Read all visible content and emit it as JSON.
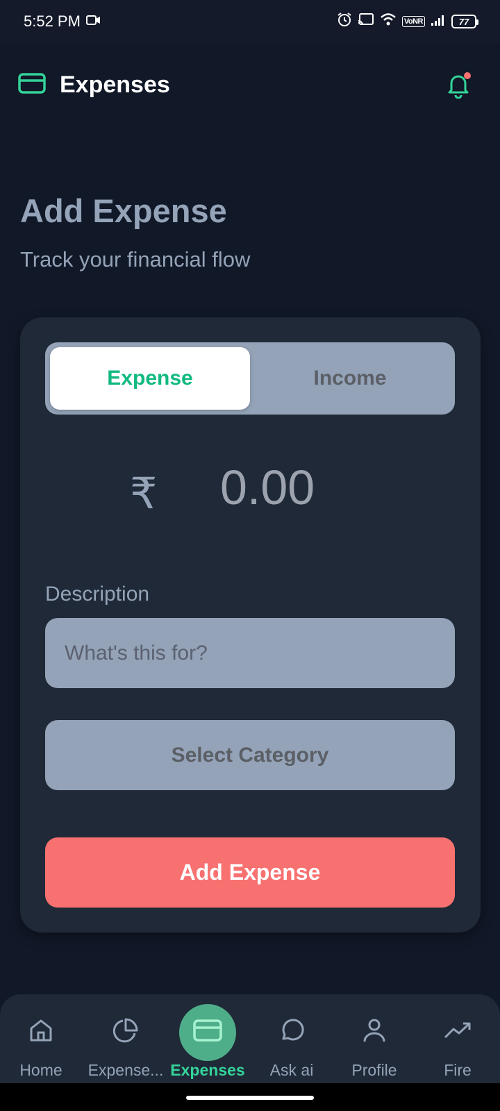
{
  "status_bar": {
    "time": "5:52 PM",
    "vonr": "VoNR",
    "battery": "77"
  },
  "header": {
    "title": "Expenses"
  },
  "page": {
    "title": "Add Expense",
    "subtitle": "Track your financial flow"
  },
  "form": {
    "toggle": {
      "expense_label": "Expense",
      "income_label": "Income",
      "selected": "Expense"
    },
    "currency_symbol": "₹",
    "amount": "0.00",
    "description_label": "Description",
    "description_placeholder": "What's this for?",
    "category_placeholder": "Select Category",
    "submit_label": "Add Expense"
  },
  "bottom_nav": {
    "items": [
      {
        "label": "Home",
        "icon": "home-icon"
      },
      {
        "label": "Expense...",
        "icon": "pie-chart-icon"
      },
      {
        "label": "Expenses",
        "icon": "credit-card-icon",
        "active": true
      },
      {
        "label": "Ask ai",
        "icon": "chat-bubble-icon"
      },
      {
        "label": "Profile",
        "icon": "user-icon"
      },
      {
        "label": "Fire",
        "icon": "trending-up-icon"
      }
    ]
  },
  "colors": {
    "background": "#111827",
    "card": "#1f2937",
    "accent_green": "#10b981",
    "danger_red": "#f87171",
    "muted": "#94a3b8"
  }
}
